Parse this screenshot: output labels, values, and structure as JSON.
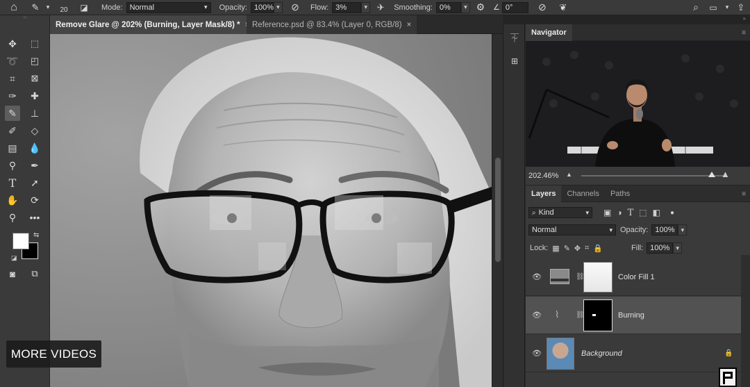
{
  "options_bar": {
    "brush_size": "20",
    "mode_label": "Mode:",
    "mode_value": "Normal",
    "opacity_label": "Opacity:",
    "opacity_value": "100%",
    "flow_label": "Flow:",
    "flow_value": "3%",
    "smoothing_label": "Smoothing:",
    "smoothing_value": "0%",
    "angle_value": "0°"
  },
  "tabs": [
    {
      "label": "Remove Glare @ 202% (Burning, Layer Mask/8) *",
      "close": "×"
    },
    {
      "label": "Reference.psd @ 83.4% (Layer 0, RGB/8)",
      "close": "×"
    }
  ],
  "overlay": {
    "more_videos": "MORE VIDEOS"
  },
  "navigator": {
    "title": "Navigator",
    "zoom": "202.46%"
  },
  "layers_panel": {
    "tabs": [
      "Layers",
      "Channels",
      "Paths"
    ],
    "filter_kind": "Kind",
    "blend_mode": "Normal",
    "opacity_label": "Opacity:",
    "opacity_value": "100%",
    "lock_label": "Lock:",
    "fill_label": "Fill:",
    "fill_value": "100%",
    "layers": [
      {
        "name": "Color Fill 1",
        "selected": false
      },
      {
        "name": "Burning",
        "selected": true
      },
      {
        "name": "Background",
        "selected": false,
        "locked": true
      }
    ]
  },
  "colors": {
    "accent": "#525252",
    "panel": "#3a3a3a",
    "canvas_bg": "#8d8d8d"
  }
}
